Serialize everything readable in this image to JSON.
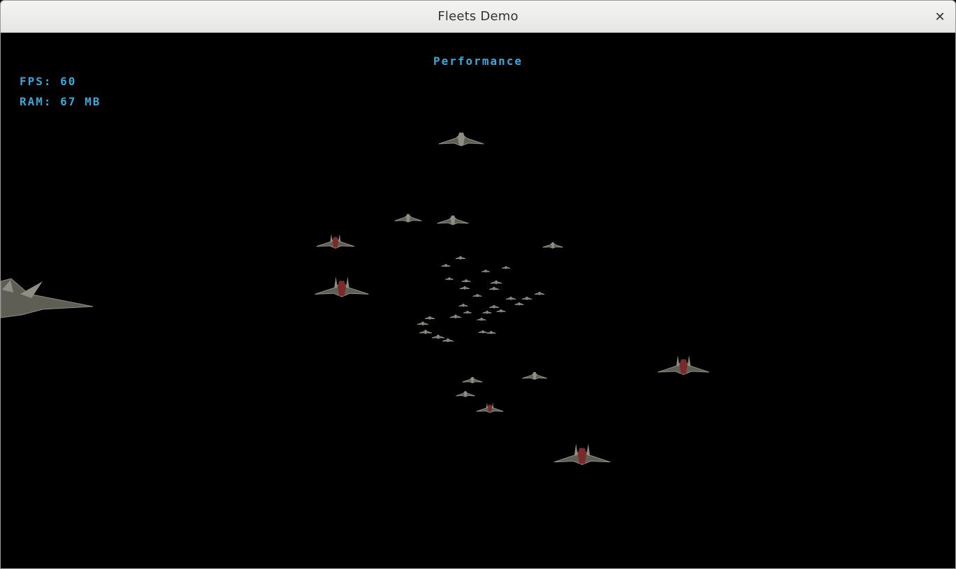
{
  "window": {
    "title": "Fleets Demo",
    "close_icon": "close-icon"
  },
  "hud": {
    "title": "Performance",
    "fps": "FPS: 60",
    "ram": "RAM: 67 MB",
    "text_color": "#3ea6d6"
  },
  "scene": {
    "background": "#000000",
    "ship_color": "#5e5e55",
    "ship_highlight": "#8e8e84",
    "ship_accent": "#7a2a2a"
  }
}
